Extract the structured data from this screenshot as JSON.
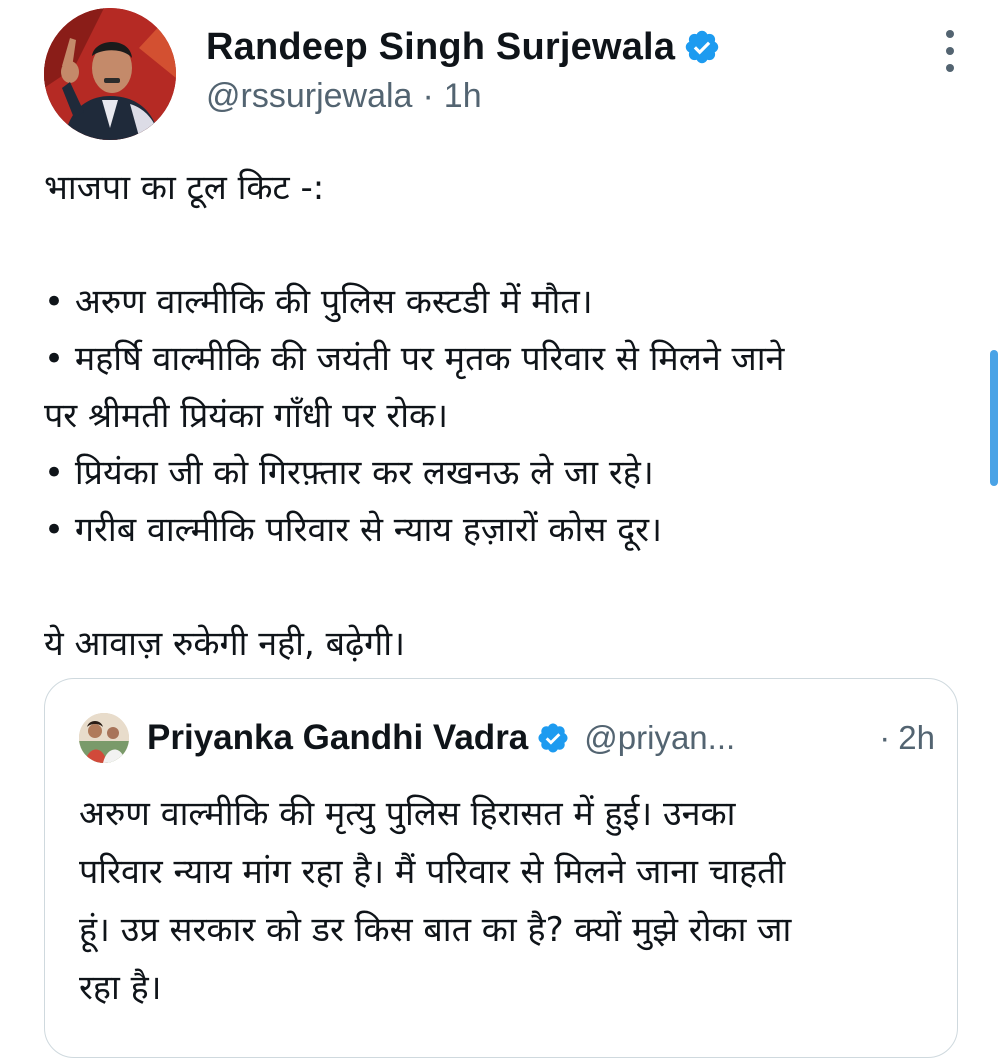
{
  "tweet": {
    "author": {
      "display_name": "Randeep Singh Surjewala",
      "verified": true,
      "handle": "@rssurjewala",
      "separator": "·",
      "time": "1h",
      "avatar_icon": "profile-photo"
    },
    "body_lines": [
      "भाजपा का टूल किट -:",
      "",
      "• अरुण वाल्मीकि की पुलिस कस्टडी में मौत।",
      "• महर्षि वाल्मीकि की जयंती पर मृतक परिवार से मिलने जाने",
      "पर श्रीमती प्रियंका गाँधी पर रोक।",
      "• प्रियंका जी को गिरफ़्तार कर लखनऊ ले जा रहे।",
      "• गरीब वाल्मीकि परिवार से न्याय हज़ारों कोस दूर।",
      "",
      "ये आवाज़ रुकेगी नही, बढ़ेगी।"
    ],
    "more_icon": "more-vertical-icon",
    "verified_color": "#1d9bf0"
  },
  "quoted_tweet": {
    "author": {
      "display_name": "Priyanka Gandhi Vadra",
      "verified": true,
      "handle": "@priyan...",
      "separator": "·",
      "time": "2h"
    },
    "body_lines": [
      "अरुण वाल्मीकि की मृत्यु पुलिस हिरासत में हुई। उनका",
      "परिवार न्याय मांग रहा है। मैं परिवार से मिलने जाना चाहती",
      "हूं। उप्र सरकार को डर किस बात का है? क्यों मुझे रोका जा",
      "रहा है।"
    ]
  },
  "colors": {
    "text_primary": "#0f1419",
    "text_secondary": "#536471",
    "border": "#cfd9de",
    "accent": "#1d9bf0"
  }
}
